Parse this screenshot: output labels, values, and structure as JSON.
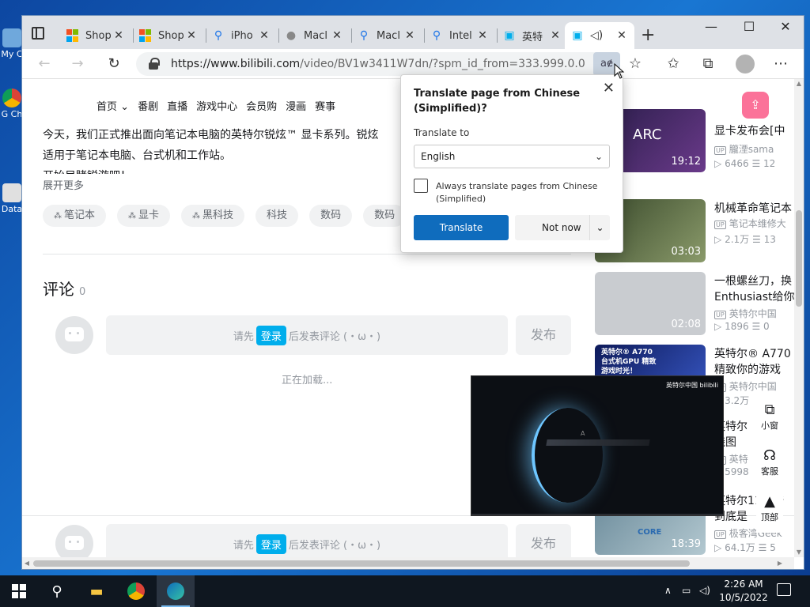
{
  "desktop": {
    "icons": [
      {
        "label": "My C"
      },
      {
        "label": "G Ch"
      },
      {
        "label": "Data"
      }
    ]
  },
  "tabs": [
    {
      "label": "Shop",
      "favicon": "microsoft-logo-icon"
    },
    {
      "label": "Shop",
      "favicon": "microsoft-logo-icon"
    },
    {
      "label": "iPho",
      "favicon": "search-icon"
    },
    {
      "label": "Macl",
      "favicon": "apple-icon"
    },
    {
      "label": "Macl",
      "favicon": "search-icon"
    },
    {
      "label": "Intel",
      "favicon": "search-icon"
    },
    {
      "label": "英特",
      "favicon": "bilibili-icon"
    },
    {
      "label": "",
      "favicon": "bilibili-icon",
      "active": true
    }
  ],
  "address_bar": {
    "url_host": "https://www.bilibili.com",
    "url_rest": "/video/BV1w3411W7dn/?spm_id_from=333.999.0.0",
    "translate_glyph": "aɇ"
  },
  "site_nav": [
    "首页",
    "番剧",
    "直播",
    "游戏中心",
    "会员购",
    "漫画",
    "赛事"
  ],
  "description": {
    "lines": [
      "今天，我们正式推出面向笔记本电脑的英特尔锐炫™ 显卡系列。锐炫",
      "适用于笔记本电脑、台式机和工作站。",
      "开始目睹锐游吧！"
    ],
    "expand_label": "展开更多"
  },
  "tags": [
    {
      "label": "笔记本",
      "icon": true
    },
    {
      "label": "显卡",
      "icon": true
    },
    {
      "label": "黑科技",
      "icon": true
    },
    {
      "label": "科技",
      "icon": false
    },
    {
      "label": "数码",
      "icon": false
    },
    {
      "label": "数码",
      "icon": false
    }
  ],
  "comments": {
    "title": "评论",
    "count": "0",
    "prompt_before": "请先",
    "login_label": "登录",
    "prompt_after": "后发表评论 (・ω・)",
    "publish_label": "发布",
    "loading_text": "正在加载..."
  },
  "recommendations": [
    {
      "title": "显卡发布会[中",
      "up": "朧湮sama",
      "views": "6466",
      "danmaku": "12",
      "duration": "19:12",
      "thumb_text": "ARC",
      "thumb_color": "#3b2a5a"
    },
    {
      "title": "机械革命笔记本",
      "up": "笔记本维修大",
      "views": "2.1万",
      "danmaku": "13",
      "duration": "03:03",
      "thumb_text": "",
      "thumb_color": "#4a5e3a"
    },
    {
      "title": "一根螺丝刀，换",
      "title2": "Enthusiast给你",
      "up": "英特尔中国",
      "views": "1896",
      "danmaku": "0",
      "duration": "02:08",
      "thumb_text": "",
      "thumb_color": "#c9ccd0"
    },
    {
      "title": "英特尔® A770",
      "title2": "精致你的游戏",
      "up": "英特尔中国",
      "views": "3.2万",
      "danmaku": "",
      "duration": "",
      "thumb_text": "英特尔® A770 台式机GPU 精致游戏时光！",
      "thumb_color": "#1a2a6a"
    },
    {
      "title": "英特尔",
      "title2": "线图",
      "up": "英特",
      "views": "5998",
      "danmaku": "",
      "duration": "",
      "thumb_text": "",
      "thumb_color": "#ffffff"
    },
    {
      "title": "英特尔11代酷",
      "title2": "到底是",
      "up": "极客湾Geek",
      "views": "64.1万",
      "danmaku": "5",
      "duration": "18:39",
      "thumb_text": "CORE",
      "thumb_color": "#5a7a8a"
    }
  ],
  "side_tools": [
    {
      "label": "小窗",
      "icon": "mini-window-icon"
    },
    {
      "label": "客服",
      "icon": "headset-icon"
    },
    {
      "label": "顶部",
      "icon": "back-to-top-icon"
    }
  ],
  "mini_player": {
    "brand": "英特尔中国 bilibili",
    "letter": "A"
  },
  "translate_popup": {
    "title": "Translate page from Chinese (Simplified)?",
    "translate_to_label": "Translate to",
    "language": "English",
    "always_label": "Always translate pages from Chinese (Simplified)",
    "translate_button": "Translate",
    "not_now_button": "Not now"
  },
  "taskbar": {
    "time": "2:26 AM",
    "date": "10/5/2022"
  },
  "colors": {
    "translate_blue": "#0f6cbd",
    "bilibili_blue": "#00aeec",
    "bilibili_pink": "#fb7299"
  }
}
